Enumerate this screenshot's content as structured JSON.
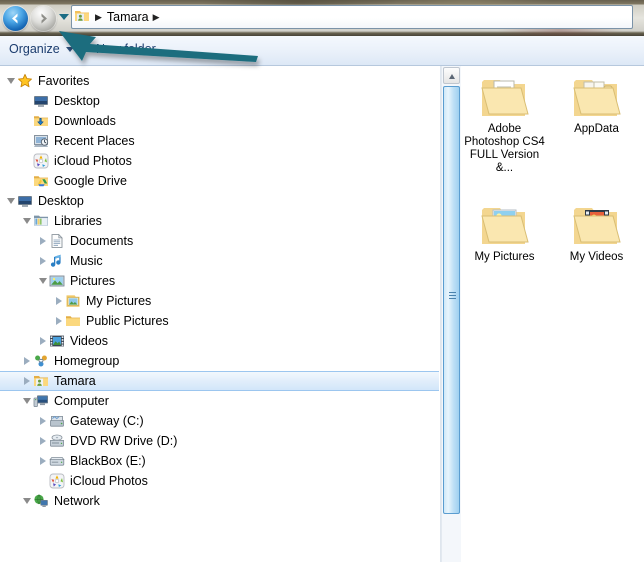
{
  "window": {
    "address": {
      "icon": "user-folder-icon",
      "crumbs": [
        "Tamara"
      ],
      "separator": "▶"
    },
    "nav": {
      "back_label": "Back",
      "forward_label": "Forward",
      "recent_label": "Recent pages"
    }
  },
  "toolbar": {
    "organize_label": "Organize",
    "new_folder_label": "New folder"
  },
  "sidebar": {
    "items": [
      {
        "label": "Favorites",
        "icon": "star-icon",
        "indent": 0,
        "twisty": "open",
        "selected": false
      },
      {
        "label": "Desktop",
        "icon": "monitor-icon",
        "indent": 1,
        "twisty": "none",
        "selected": false
      },
      {
        "label": "Downloads",
        "icon": "downloads-icon",
        "indent": 1,
        "twisty": "none",
        "selected": false
      },
      {
        "label": "Recent Places",
        "icon": "recent-places-icon",
        "indent": 1,
        "twisty": "none",
        "selected": false
      },
      {
        "label": "iCloud Photos",
        "icon": "icloud-photos-icon",
        "indent": 1,
        "twisty": "none",
        "selected": false
      },
      {
        "label": "Google Drive",
        "icon": "google-drive-icon",
        "indent": 1,
        "twisty": "none",
        "selected": false
      },
      {
        "label": "Desktop",
        "icon": "monitor-icon",
        "indent": 0,
        "twisty": "open",
        "selected": false
      },
      {
        "label": "Libraries",
        "icon": "libraries-icon",
        "indent": 1,
        "twisty": "open",
        "selected": false
      },
      {
        "label": "Documents",
        "icon": "documents-icon",
        "indent": 2,
        "twisty": "closed",
        "selected": false
      },
      {
        "label": "Music",
        "icon": "music-icon",
        "indent": 2,
        "twisty": "closed",
        "selected": false
      },
      {
        "label": "Pictures",
        "icon": "pictures-icon",
        "indent": 2,
        "twisty": "open",
        "selected": false
      },
      {
        "label": "My Pictures",
        "icon": "my-pictures-icon",
        "indent": 3,
        "twisty": "closed",
        "selected": false
      },
      {
        "label": "Public Pictures",
        "icon": "folder-icon",
        "indent": 3,
        "twisty": "closed",
        "selected": false
      },
      {
        "label": "Videos",
        "icon": "videos-icon",
        "indent": 2,
        "twisty": "closed",
        "selected": false
      },
      {
        "label": "Homegroup",
        "icon": "homegroup-icon",
        "indent": 1,
        "twisty": "closed",
        "selected": false
      },
      {
        "label": "Tamara",
        "icon": "user-folder-icon",
        "indent": 1,
        "twisty": "closed",
        "selected": true
      },
      {
        "label": "Computer",
        "icon": "computer-icon",
        "indent": 1,
        "twisty": "open",
        "selected": false
      },
      {
        "label": "Gateway (C:)",
        "icon": "hard-drive-icon",
        "indent": 2,
        "twisty": "closed",
        "selected": false
      },
      {
        "label": "DVD RW Drive (D:)",
        "icon": "dvd-drive-icon",
        "indent": 2,
        "twisty": "closed",
        "selected": false
      },
      {
        "label": "BlackBox (E:)",
        "icon": "removable-drive-icon",
        "indent": 2,
        "twisty": "closed",
        "selected": false
      },
      {
        "label": "iCloud Photos",
        "icon": "icloud-photos-icon",
        "indent": 2,
        "twisty": "none",
        "selected": false
      },
      {
        "label": "Network",
        "icon": "network-icon",
        "indent": 1,
        "twisty": "open",
        "selected": false
      }
    ]
  },
  "content": {
    "items": [
      {
        "label": "Adobe Photoshop CS4 FULL Version &...",
        "icon": "folder-with-document-icon"
      },
      {
        "label": "AppData",
        "icon": "folder-with-files-icon"
      },
      {
        "label": "My Pictures",
        "icon": "folder-pictures-icon"
      },
      {
        "label": "My Videos",
        "icon": "folder-videos-icon"
      }
    ]
  },
  "scrollbar": {
    "up_arrow_label": "Scroll up",
    "thumb_label": "Vertical scroll thumb"
  },
  "annotation": {
    "arrow_label": "teal arrow pointing to back button",
    "color": "#1b6d7e"
  },
  "colors": {
    "selection_border": "#9cc6ef",
    "toolbar_text": "#1b3c6e",
    "annotation_teal": "#1b6d7e"
  }
}
